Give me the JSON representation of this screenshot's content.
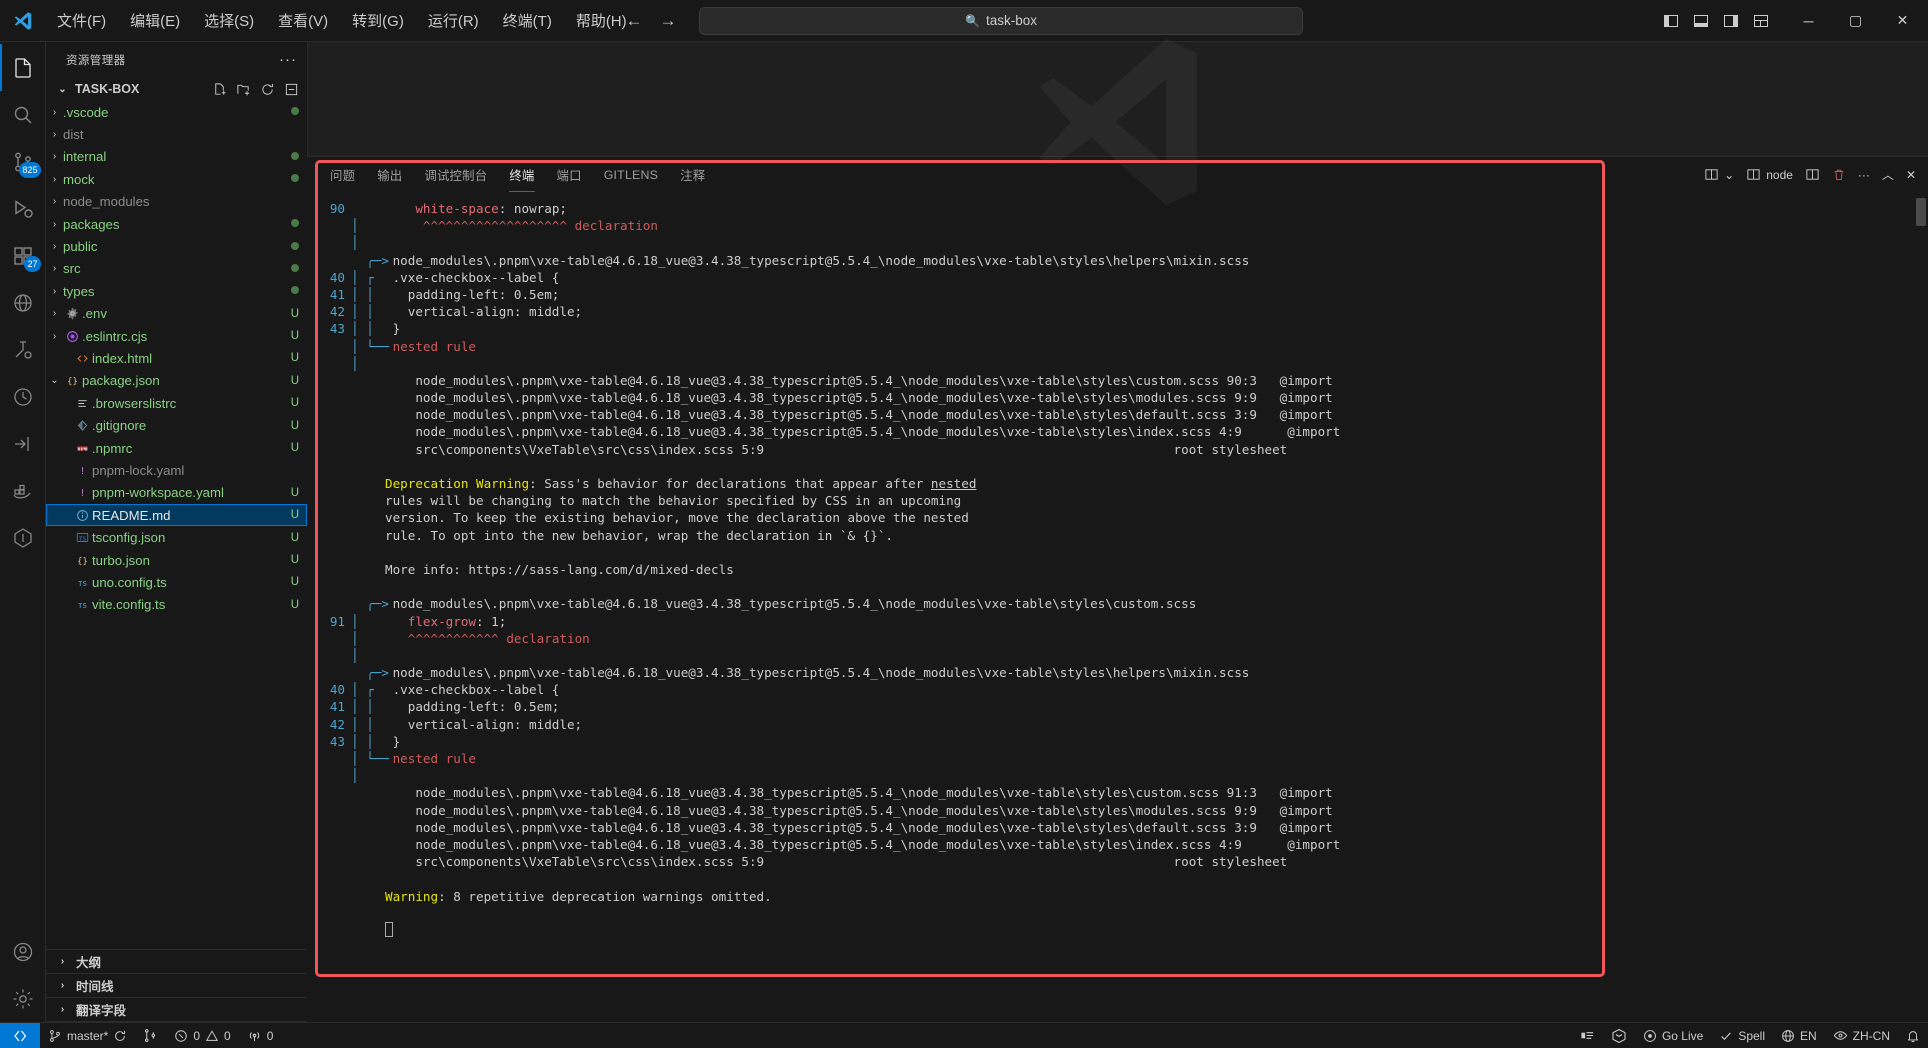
{
  "window": {
    "title": "task-box",
    "search_placeholder": "task-box",
    "menu": [
      "文件(F)",
      "编辑(E)",
      "选择(S)",
      "查看(V)",
      "转到(G)",
      "运行(R)",
      "终端(T)",
      "帮助(H)"
    ],
    "controls": {
      "minimize": "─",
      "maximize": "▢",
      "close": "✕"
    }
  },
  "activitybar": {
    "items": [
      {
        "name": "explorer",
        "badge": ""
      },
      {
        "name": "search",
        "badge": ""
      },
      {
        "name": "source-control",
        "badge": "825"
      },
      {
        "name": "run-debug",
        "badge": ""
      },
      {
        "name": "extensions",
        "badge": "27"
      },
      {
        "name": "remote-explorer",
        "badge": ""
      },
      {
        "name": "test",
        "badge": ""
      },
      {
        "name": "timeline",
        "badge": ""
      },
      {
        "name": "import-cost",
        "badge": ""
      },
      {
        "name": "docker",
        "badge": ""
      },
      {
        "name": "todo-tree",
        "badge": ""
      }
    ],
    "bottom": [
      {
        "name": "accounts"
      },
      {
        "name": "settings"
      }
    ]
  },
  "sidebar": {
    "title": "资源管理器",
    "more_label": "···",
    "project": "TASK-BOX",
    "project_actions": [
      "new-file",
      "new-folder",
      "refresh",
      "collapse-all"
    ],
    "files": [
      {
        "label": ".vscode",
        "type": "folder",
        "indent": 1,
        "icon": "chevron",
        "color": "#89d185",
        "status": "",
        "dot": true
      },
      {
        "label": "dist",
        "type": "folder",
        "indent": 1,
        "icon": "chevron",
        "color": "#8c8c8c",
        "status": "",
        "dot": false
      },
      {
        "label": "internal",
        "type": "folder",
        "indent": 1,
        "icon": "chevron",
        "color": "#89d185",
        "status": "",
        "dot": true
      },
      {
        "label": "mock",
        "type": "folder",
        "indent": 1,
        "icon": "chevron",
        "color": "#89d185",
        "status": "",
        "dot": true
      },
      {
        "label": "node_modules",
        "type": "folder",
        "indent": 1,
        "icon": "chevron",
        "color": "#8c8c8c",
        "status": "",
        "dot": false
      },
      {
        "label": "packages",
        "type": "folder",
        "indent": 1,
        "icon": "chevron",
        "color": "#89d185",
        "status": "",
        "dot": true
      },
      {
        "label": "public",
        "type": "folder",
        "indent": 1,
        "icon": "chevron",
        "color": "#89d185",
        "status": "",
        "dot": true
      },
      {
        "label": "src",
        "type": "folder",
        "indent": 1,
        "icon": "chevron",
        "color": "#89d185",
        "status": "",
        "dot": true
      },
      {
        "label": "types",
        "type": "folder",
        "indent": 1,
        "icon": "chevron",
        "color": "#89d185",
        "status": "",
        "dot": true
      },
      {
        "label": ".env",
        "type": "file",
        "indent": 1,
        "icon": "gear",
        "color": "#89d185",
        "status": "U",
        "dot": false
      },
      {
        "label": ".eslintrc.cjs",
        "type": "file",
        "indent": 1,
        "icon": "eslint",
        "color": "#89d185",
        "status": "U",
        "dot": false
      },
      {
        "label": "index.html",
        "type": "file",
        "indent": 2,
        "icon": "html",
        "color": "#89d185",
        "status": "U",
        "dot": false
      },
      {
        "label": "package.json",
        "type": "file",
        "indent": 1,
        "icon": "json",
        "color": "#89d185",
        "status": "U",
        "dot": false,
        "expanded": true
      },
      {
        "label": ".browserslistrc",
        "type": "file",
        "indent": 2,
        "icon": "list",
        "color": "#89d185",
        "status": "U",
        "dot": false
      },
      {
        "label": ".gitignore",
        "type": "file",
        "indent": 2,
        "icon": "git",
        "color": "#89d185",
        "status": "U",
        "dot": false
      },
      {
        "label": ".npmrc",
        "type": "file",
        "indent": 2,
        "icon": "npm",
        "color": "#89d185",
        "status": "U",
        "dot": false
      },
      {
        "label": "pnpm-lock.yaml",
        "type": "file",
        "indent": 2,
        "icon": "yaml",
        "color": "#8c8c8c",
        "status": "",
        "dot": false
      },
      {
        "label": "pnpm-workspace.yaml",
        "type": "file",
        "indent": 2,
        "icon": "yaml",
        "color": "#89d185",
        "status": "U",
        "dot": false
      },
      {
        "label": "README.md",
        "type": "file",
        "indent": 2,
        "icon": "info",
        "color": "#e7e7e7",
        "status": "U",
        "dot": false,
        "selected": true
      },
      {
        "label": "tsconfig.json",
        "type": "file",
        "indent": 2,
        "icon": "tsconf",
        "color": "#89d185",
        "status": "U",
        "dot": false
      },
      {
        "label": "turbo.json",
        "type": "file",
        "indent": 2,
        "icon": "json",
        "color": "#89d185",
        "status": "U",
        "dot": false
      },
      {
        "label": "uno.config.ts",
        "type": "file",
        "indent": 2,
        "icon": "ts",
        "color": "#89d185",
        "status": "U",
        "dot": false
      },
      {
        "label": "vite.config.ts",
        "type": "file",
        "indent": 2,
        "icon": "ts",
        "color": "#89d185",
        "status": "U",
        "dot": false
      }
    ],
    "bottom_sections": [
      "大纲",
      "时间线",
      "翻译字段"
    ]
  },
  "panel": {
    "tabs": [
      {
        "label": "问题",
        "active": false
      },
      {
        "label": "输出",
        "active": false
      },
      {
        "label": "调试控制台",
        "active": false
      },
      {
        "label": "终端",
        "active": true
      },
      {
        "label": "端口",
        "active": false
      },
      {
        "label": "GITLENS",
        "active": false
      },
      {
        "label": "注释",
        "active": false
      }
    ],
    "actions": {
      "split_dropdown": "⌄",
      "terminal_name": "node",
      "split_label": "split-terminal",
      "kill_label": "kill-terminal",
      "more": "···",
      "maximize": "︿",
      "close": "✕"
    }
  },
  "terminal": {
    "lines": [
      {
        "ln": "90",
        "gut": "",
        "segs": [
          {
            "t": "    ",
            "c": ""
          },
          {
            "t": "white-space",
            "c": "red"
          },
          {
            "t": ": nowrap;",
            "c": ""
          }
        ]
      },
      {
        "ln": "",
        "gut": "│",
        "segs": [
          {
            "t": "     ^^^^^^^^^^^^^^^^^^^ ",
            "c": "redc"
          },
          {
            "t": "declaration",
            "c": "redc"
          }
        ]
      },
      {
        "ln": "",
        "gut": "│",
        "segs": []
      },
      {
        "ln": "",
        "gut": "  ╭─>",
        "segs": [
          {
            "t": " node_modules\\.pnpm\\vxe-table@4.6.18_vue@3.4.38_typescript@5.5.4_\\node_modules\\vxe-table\\styles\\helpers\\mixin.scss",
            "c": ""
          }
        ]
      },
      {
        "ln": "40",
        "gut": "│ ┌",
        "segs": [
          {
            "t": " .vxe-checkbox--label {",
            "c": ""
          }
        ]
      },
      {
        "ln": "41",
        "gut": "│ │",
        "segs": [
          {
            "t": "   padding-left: 0.5em;",
            "c": ""
          }
        ]
      },
      {
        "ln": "42",
        "gut": "│ │",
        "segs": [
          {
            "t": "   vertical-align: middle;",
            "c": ""
          }
        ]
      },
      {
        "ln": "43",
        "gut": "│ │",
        "segs": [
          {
            "t": " }",
            "c": ""
          }
        ]
      },
      {
        "ln": "",
        "gut": "│ └──",
        "segs": [
          {
            "t": " nested rule",
            "c": "redc"
          }
        ]
      },
      {
        "ln": "",
        "gut": "│",
        "segs": []
      },
      {
        "ln": "",
        "gut": "",
        "segs": [
          {
            "t": "    node_modules\\.pnpm\\vxe-table@4.6.18_vue@3.4.38_typescript@5.5.4_\\node_modules\\vxe-table\\styles\\custom.scss 90:3   @import",
            "c": ""
          }
        ]
      },
      {
        "ln": "",
        "gut": "",
        "segs": [
          {
            "t": "    node_modules\\.pnpm\\vxe-table@4.6.18_vue@3.4.38_typescript@5.5.4_\\node_modules\\vxe-table\\styles\\modules.scss 9:9   @import",
            "c": ""
          }
        ]
      },
      {
        "ln": "",
        "gut": "",
        "segs": [
          {
            "t": "    node_modules\\.pnpm\\vxe-table@4.6.18_vue@3.4.38_typescript@5.5.4_\\node_modules\\vxe-table\\styles\\default.scss 3:9   @import",
            "c": ""
          }
        ]
      },
      {
        "ln": "",
        "gut": "",
        "segs": [
          {
            "t": "    node_modules\\.pnpm\\vxe-table@4.6.18_vue@3.4.38_typescript@5.5.4_\\node_modules\\vxe-table\\styles\\index.scss 4:9      @import",
            "c": ""
          }
        ]
      },
      {
        "ln": "",
        "gut": "",
        "segs": [
          {
            "t": "    src\\components\\VxeTable\\src\\css\\index.scss 5:9                                                      root stylesheet",
            "c": ""
          }
        ]
      },
      {
        "ln": "",
        "gut": "",
        "segs": []
      },
      {
        "ln": "",
        "gut": "",
        "segs": [
          {
            "t": "Deprecation Warning",
            "c": "yel"
          },
          {
            "t": ": Sass's behavior for declarations that appear after ",
            "c": ""
          },
          {
            "t": "nested",
            "c": "ul"
          }
        ]
      },
      {
        "ln": "",
        "gut": "",
        "segs": [
          {
            "t": "rules will be changing to match the behavior specified by CSS in an upcoming",
            "c": ""
          }
        ]
      },
      {
        "ln": "",
        "gut": "",
        "segs": [
          {
            "t": "version. To keep the existing behavior, move the declaration above the nested",
            "c": ""
          }
        ]
      },
      {
        "ln": "",
        "gut": "",
        "segs": [
          {
            "t": "rule. To opt into the new behavior, wrap the declaration in `& {}`.",
            "c": ""
          }
        ]
      },
      {
        "ln": "",
        "gut": "",
        "segs": []
      },
      {
        "ln": "",
        "gut": "",
        "segs": [
          {
            "t": "More info: https://sass-lang.com/d/mixed-decls",
            "c": ""
          }
        ]
      },
      {
        "ln": "",
        "gut": "",
        "segs": []
      },
      {
        "ln": "",
        "gut": "  ╭─>",
        "segs": [
          {
            "t": " node_modules\\.pnpm\\vxe-table@4.6.18_vue@3.4.38_typescript@5.5.4_\\node_modules\\vxe-table\\styles\\custom.scss",
            "c": ""
          }
        ]
      },
      {
        "ln": "91",
        "gut": "│",
        "segs": [
          {
            "t": "   ",
            "c": ""
          },
          {
            "t": "flex-grow",
            "c": "red"
          },
          {
            "t": ": 1;",
            "c": ""
          }
        ]
      },
      {
        "ln": "",
        "gut": "│",
        "segs": [
          {
            "t": "   ^^^^^^^^^^^^ ",
            "c": "redc"
          },
          {
            "t": "declaration",
            "c": "redc"
          }
        ]
      },
      {
        "ln": "",
        "gut": "│",
        "segs": []
      },
      {
        "ln": "",
        "gut": "  ╭─>",
        "segs": [
          {
            "t": " node_modules\\.pnpm\\vxe-table@4.6.18_vue@3.4.38_typescript@5.5.4_\\node_modules\\vxe-table\\styles\\helpers\\mixin.scss",
            "c": ""
          }
        ]
      },
      {
        "ln": "40",
        "gut": "│ ┌",
        "segs": [
          {
            "t": " .vxe-checkbox--label {",
            "c": ""
          }
        ]
      },
      {
        "ln": "41",
        "gut": "│ │",
        "segs": [
          {
            "t": "   padding-left: 0.5em;",
            "c": ""
          }
        ]
      },
      {
        "ln": "42",
        "gut": "│ │",
        "segs": [
          {
            "t": "   vertical-align: middle;",
            "c": ""
          }
        ]
      },
      {
        "ln": "43",
        "gut": "│ │",
        "segs": [
          {
            "t": " }",
            "c": ""
          }
        ]
      },
      {
        "ln": "",
        "gut": "│ └──",
        "segs": [
          {
            "t": " nested rule",
            "c": "redc"
          }
        ]
      },
      {
        "ln": "",
        "gut": "│",
        "segs": []
      },
      {
        "ln": "",
        "gut": "",
        "segs": [
          {
            "t": "    node_modules\\.pnpm\\vxe-table@4.6.18_vue@3.4.38_typescript@5.5.4_\\node_modules\\vxe-table\\styles\\custom.scss 91:3   @import",
            "c": ""
          }
        ]
      },
      {
        "ln": "",
        "gut": "",
        "segs": [
          {
            "t": "    node_modules\\.pnpm\\vxe-table@4.6.18_vue@3.4.38_typescript@5.5.4_\\node_modules\\vxe-table\\styles\\modules.scss 9:9   @import",
            "c": ""
          }
        ]
      },
      {
        "ln": "",
        "gut": "",
        "segs": [
          {
            "t": "    node_modules\\.pnpm\\vxe-table@4.6.18_vue@3.4.38_typescript@5.5.4_\\node_modules\\vxe-table\\styles\\default.scss 3:9   @import",
            "c": ""
          }
        ]
      },
      {
        "ln": "",
        "gut": "",
        "segs": [
          {
            "t": "    node_modules\\.pnpm\\vxe-table@4.6.18_vue@3.4.38_typescript@5.5.4_\\node_modules\\vxe-table\\styles\\index.scss 4:9      @import",
            "c": ""
          }
        ]
      },
      {
        "ln": "",
        "gut": "",
        "segs": [
          {
            "t": "    src\\components\\VxeTable\\src\\css\\index.scss 5:9                                                      root stylesheet",
            "c": ""
          }
        ]
      },
      {
        "ln": "",
        "gut": "",
        "segs": []
      },
      {
        "ln": "",
        "gut": "",
        "segs": [
          {
            "t": "Warning",
            "c": "yel"
          },
          {
            "t": ": 8 repetitive deprecation warnings omitted.",
            "c": ""
          }
        ]
      },
      {
        "ln": "",
        "gut": "",
        "segs": []
      },
      {
        "ln": "",
        "gut": "",
        "segs": [
          {
            "t": "",
            "c": "cursor"
          }
        ]
      }
    ]
  },
  "statusbar": {
    "left": [
      {
        "name": "branch",
        "label": "master*",
        "icon": "source-control"
      },
      {
        "name": "sync",
        "label": "",
        "icon": "sync"
      },
      {
        "name": "git-graph",
        "label": "",
        "icon": "graph"
      },
      {
        "name": "problems",
        "label": "0  0",
        "errors": "0",
        "warnings": "0"
      },
      {
        "name": "ports",
        "label": "0"
      }
    ],
    "right": [
      {
        "name": "layout",
        "label": ""
      },
      {
        "name": "tabnine",
        "label": ""
      },
      {
        "name": "go-live",
        "label": "Go Live"
      },
      {
        "name": "spell",
        "label": "Spell"
      },
      {
        "name": "language",
        "label": "EN"
      },
      {
        "name": "locale",
        "label": "ZH-CN"
      },
      {
        "name": "notifications",
        "label": ""
      }
    ]
  },
  "annotation": {
    "color": "#f2555a"
  }
}
